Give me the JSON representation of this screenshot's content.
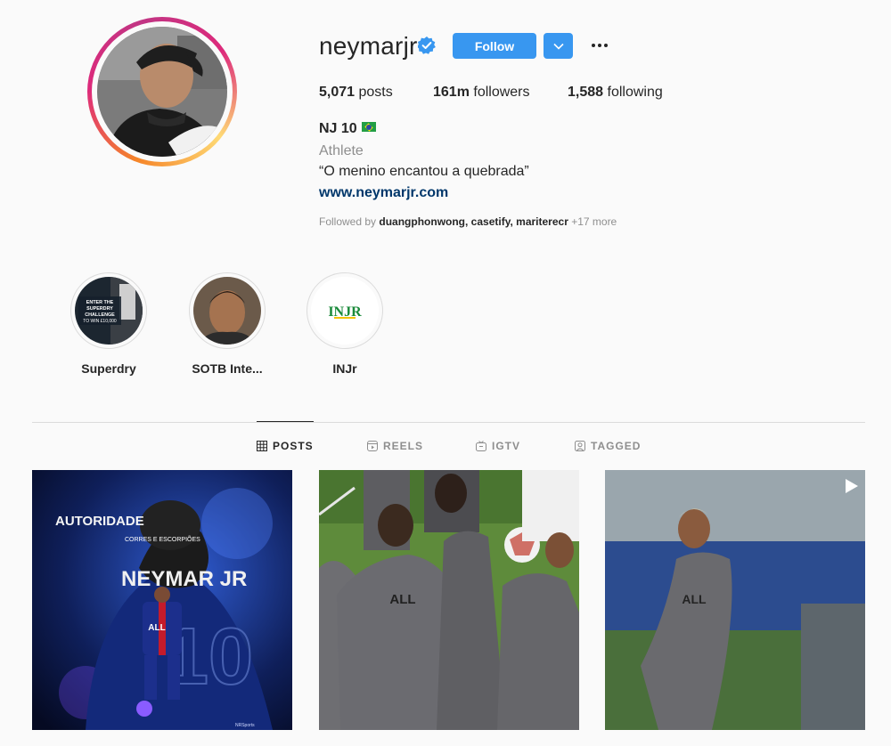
{
  "profile": {
    "username": "neymarjr",
    "follow_label": "Follow",
    "stats": {
      "posts_count": "5,071",
      "posts_label": "posts",
      "followers_count": "161m",
      "followers_label": "followers",
      "following_count": "1,588",
      "following_label": "following"
    },
    "full_name": "NJ 10",
    "category": "Athlete",
    "bio": "“O menino encantou a quebrada”",
    "website": "www.neymarjr.com",
    "followed_by": {
      "prefix": "Followed by",
      "names": "duangphonwong, casetify, mariterecr",
      "more": "+17 more"
    }
  },
  "highlights": [
    {
      "label": "Superdry",
      "image_text": "ENTER THE SUPERDRY CHALLENGE FOR A CHANCE TO WIN £10,000"
    },
    {
      "label": "SOTB Inte..."
    },
    {
      "label": "INJr",
      "logo_text": "INJR"
    }
  ],
  "tabs": [
    {
      "label": "POSTS",
      "icon": "grid-icon",
      "active": true
    },
    {
      "label": "REELS",
      "icon": "reels-icon",
      "active": false
    },
    {
      "label": "IGTV",
      "icon": "igtv-icon",
      "active": false
    },
    {
      "label": "TAGGED",
      "icon": "tagged-icon",
      "active": false
    }
  ],
  "posts": [
    {
      "headline": "AUTORIDADE",
      "tagline": "CORRES E ESCORPIÕES",
      "jersey_name": "NEYMAR JR",
      "jersey_number": "10",
      "credit": "NRSports",
      "sponsor": "ALL"
    },
    {
      "sponsor": "ALL"
    },
    {
      "sponsor": "ALL",
      "badge": "video-play-icon"
    }
  ],
  "colors": {
    "accent": "#3897f0",
    "link": "#00376b",
    "muted": "#8e8e8e",
    "text": "#262626",
    "divider": "#dbdbdb"
  }
}
